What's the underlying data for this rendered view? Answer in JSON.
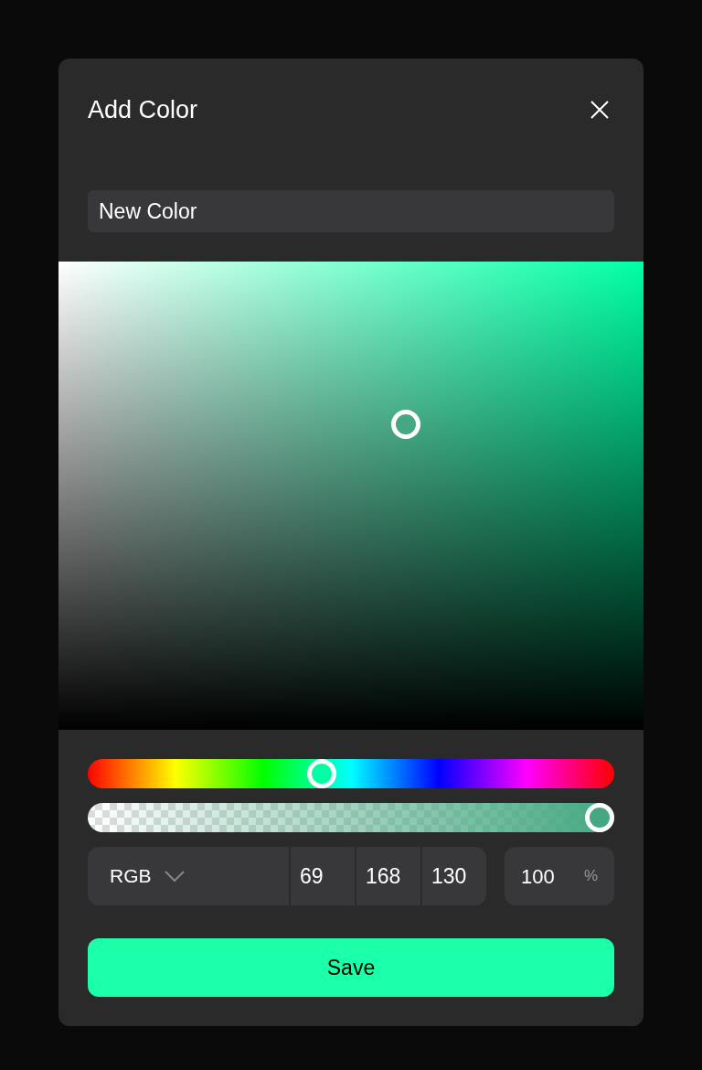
{
  "dialog": {
    "title": "Add Color"
  },
  "name_field": {
    "value": "New Color"
  },
  "color_area": {
    "saturation": {
      "level": 0.594
    },
    "brightness": {
      "level": 0.652
    }
  },
  "hue_slider": {
    "level": 0.441
  },
  "alpha_slider": {
    "level": 1
  },
  "format": {
    "label": "RGB"
  },
  "channels": [
    {
      "value": "69"
    },
    {
      "value": "168"
    },
    {
      "value": "130"
    }
  ],
  "opacity": {
    "value": "100",
    "unit": "%"
  },
  "save_button": {
    "label": "Save"
  }
}
